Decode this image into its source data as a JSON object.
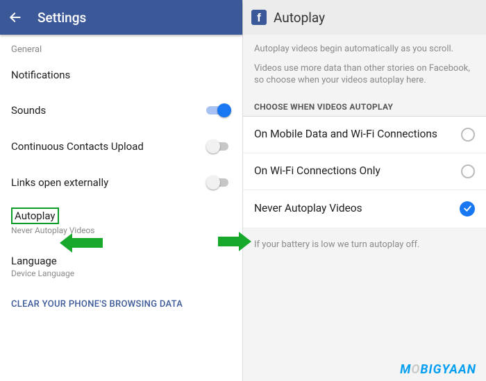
{
  "left": {
    "header": {
      "title": "Settings"
    },
    "section_general": "General",
    "items": {
      "notifications": "Notifications",
      "sounds": "Sounds",
      "contacts_upload": "Continuous Contacts Upload",
      "links_external": "Links open externally",
      "autoplay": "Autoplay",
      "autoplay_sub": "Never Autoplay Videos",
      "language": "Language",
      "language_sub": "Device Language"
    },
    "clear_data": "CLEAR YOUR PHONE'S BROWSING DATA"
  },
  "right": {
    "header": {
      "title": "Autoplay"
    },
    "desc1": "Autoplay videos begin automatically as you scroll.",
    "desc2": "Videos use more data than other stories on Facebook, so choose when your videos autoplay here.",
    "section": "CHOOSE WHEN VIDEOS AUTOPLAY",
    "options": {
      "both": "On Mobile Data and Wi-Fi Connections",
      "wifi": "On Wi-Fi Connections Only",
      "never": "Never Autoplay Videos"
    },
    "footnote": "If your battery is low we turn autoplay off."
  },
  "watermark": {
    "a": "M",
    "b": "O",
    "c": "BIGYAAN"
  }
}
